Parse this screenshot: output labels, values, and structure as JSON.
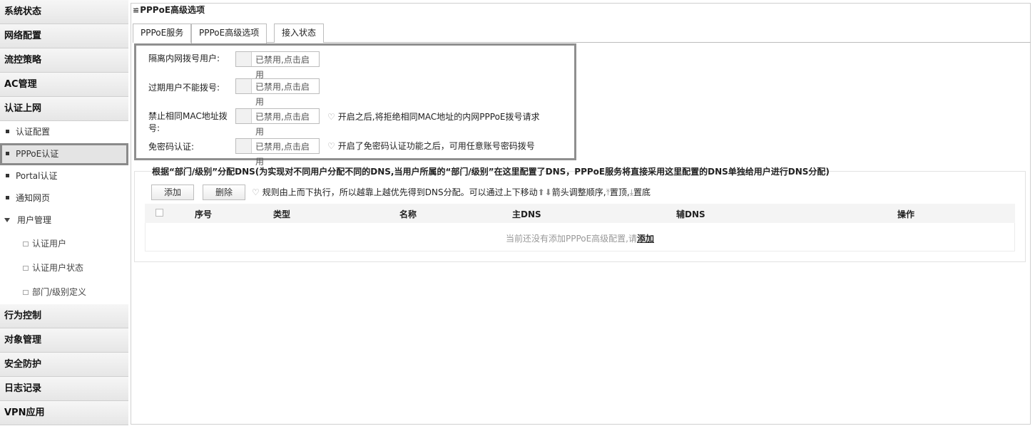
{
  "sidebar": {
    "cats_top": [
      "系统状态",
      "网络配置",
      "流控策略",
      "AC管理",
      "认证上网"
    ],
    "auth_items": [
      "认证配置",
      "PPPoE认证",
      "Portal认证",
      "通知网页"
    ],
    "user_mgmt": "用户管理",
    "user_sub": [
      "认证用户",
      "认证用户状态",
      "部门/级别定义"
    ],
    "cats_bottom": [
      "行为控制",
      "对象管理",
      "安全防护",
      "日志记录",
      "VPN应用"
    ]
  },
  "breadcrumb": {
    "icon": "≌",
    "text": "PPPoE高级选项"
  },
  "tabs": [
    "PPPoE服务",
    "PPPoE高级选项",
    "接入状态"
  ],
  "options": [
    {
      "label": "隔离内网拨号用户:",
      "toggle_line1": "已禁用,点击启",
      "toggle_line2": "用",
      "hint": ""
    },
    {
      "label": "过期用户不能拨号:",
      "toggle_line1": "已禁用,点击启",
      "toggle_line2": "用",
      "hint": ""
    },
    {
      "label_line1": "禁止相同MAC地址拨",
      "label_line2": "号:",
      "toggle_line1": "已禁用,点击启",
      "toggle_line2": "用",
      "hint": "开启之后,将拒绝相同MAC地址的内网PPPoE拨号请求"
    },
    {
      "label": "免密码认证:",
      "toggle_line1": "已禁用,点击启",
      "toggle_line2": "用",
      "hint": "开启了免密码认证功能之后，可用任意账号密码拨号"
    }
  ],
  "dns": {
    "title": "根据“部门/级别”分配DNS(为实现对不同用户分配不同的DNS,当用户所属的“部门/级别”在这里配置了DNS，PPPoE服务将直接采用这里配置的DNS单独给用户进行DNS分配)",
    "add_label": "添加",
    "delete_label": "删除",
    "rule_hint_a": "规则由上而下执行，所以越靠上越优先得到DNS分配。可以通过上下移动",
    "rule_hint_b": "箭头调整顺序,",
    "rule_hint_top": "置顶,",
    "rule_hint_bottom": "置底",
    "columns": [
      "序号",
      "类型",
      "名称",
      "主DNS",
      "辅DNS",
      "操作"
    ],
    "empty_text": "当前还没有添加PPPoE高级配置,请",
    "empty_link": "添加"
  }
}
